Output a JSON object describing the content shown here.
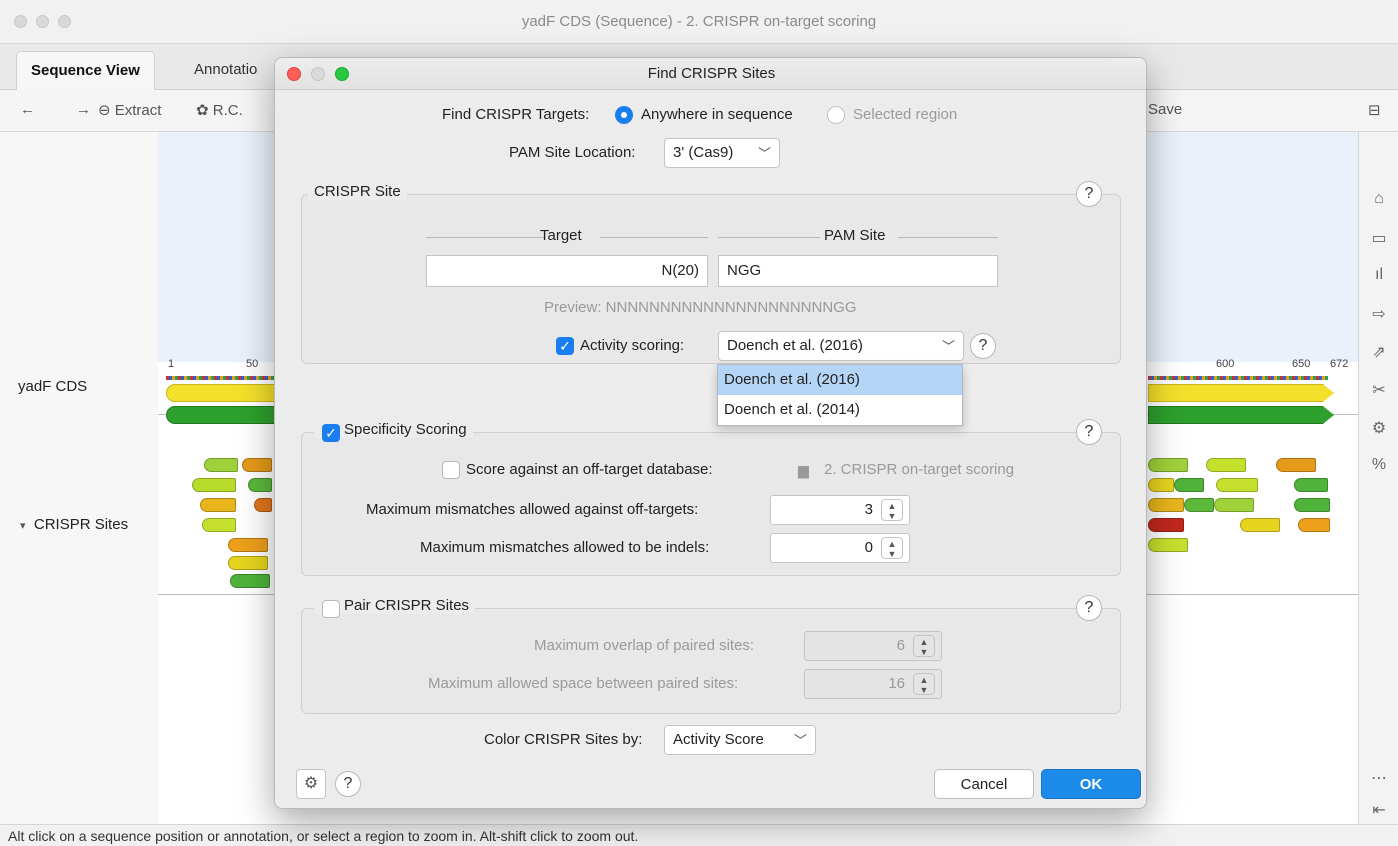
{
  "window": {
    "title": "yadF CDS (Sequence) - 2. CRISPR on-target scoring",
    "tabs": [
      {
        "label": "Sequence View"
      },
      {
        "label": "Annotatio"
      }
    ]
  },
  "toolbar": {
    "back_icon": "←",
    "forward_icon": "→",
    "extract_label": "⊖ Extract",
    "rc_label": "R.C.",
    "save_label": "Save"
  },
  "tracks": {
    "sequence_label": "yadF CDS",
    "crispr_label": "CRISPR Sites",
    "crispr_toggle": "▾",
    "ruler": [
      "1",
      "50",
      "600",
      "650",
      "672"
    ]
  },
  "status": {
    "text": "Alt click on a sequence position or annotation, or select a region to zoom in. Alt-shift click to zoom out."
  },
  "dialog": {
    "title": "Find CRISPR Sites",
    "find_targets": {
      "label": "Find CRISPR Targets:",
      "option_anywhere": "Anywhere in sequence",
      "option_selected": "Selected region"
    },
    "pam_location": {
      "label": "PAM Site Location:",
      "value": "3' (Cas9)"
    },
    "crispr_site": {
      "title": "CRISPR Site",
      "target_header": "Target",
      "pam_header": "PAM Site",
      "target_value": "N(20)",
      "pam_value": "NGG",
      "preview": "Preview: NNNNNNNNNNNNNNNNNNNNNGG",
      "activity_label": "Activity scoring:",
      "activity_value": "Doench et al. (2016)",
      "activity_options": [
        "Doench et al. (2016)",
        "Doench et al. (2014)"
      ]
    },
    "specificity": {
      "title": "Specificity Scoring",
      "offtarget_label": "Score against an off-target database:",
      "offtarget_db": "2. CRISPR on-target scoring",
      "mismatch_label": "Maximum mismatches allowed against off-targets:",
      "mismatch_value": "3",
      "indel_label": "Maximum mismatches allowed to be indels:",
      "indel_value": "0"
    },
    "pair": {
      "title": "Pair CRISPR Sites",
      "overlap_label": "Maximum overlap of paired sites:",
      "overlap_value": "6",
      "space_label": "Maximum allowed space between paired sites:",
      "space_value": "16"
    },
    "color_by": {
      "label": "Color CRISPR Sites by:",
      "value": "Activity Score"
    },
    "buttons": {
      "cancel": "Cancel",
      "ok": "OK"
    },
    "help_glyph": "?"
  },
  "colors": {
    "accent": "#1a7ef0",
    "ok_button": "#1b8ae8",
    "cds_yellow": "#f3e02a",
    "cds_green": "#2ea02e"
  }
}
